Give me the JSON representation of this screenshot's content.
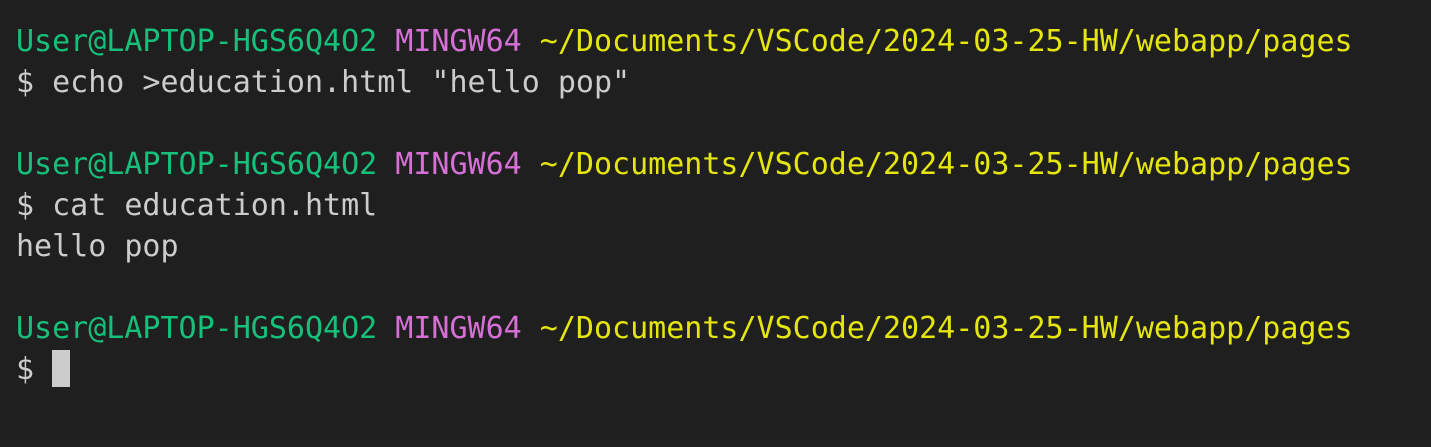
{
  "colors": {
    "background": "#1f1f1f",
    "user": "#16c07b",
    "system": "#d670d6",
    "path": "#e5e510",
    "text": "#cccccc"
  },
  "prompt": {
    "user_host": "User@LAPTOP-HGS6Q4O2",
    "system": "MINGW64",
    "path": "~/Documents/VSCode/2024-03-25-HW/webapp/pages",
    "symbol": "$"
  },
  "commands": [
    {
      "command": "echo >education.html \"hello pop\"",
      "output": ""
    },
    {
      "command": "cat education.html",
      "output": "hello pop"
    }
  ]
}
